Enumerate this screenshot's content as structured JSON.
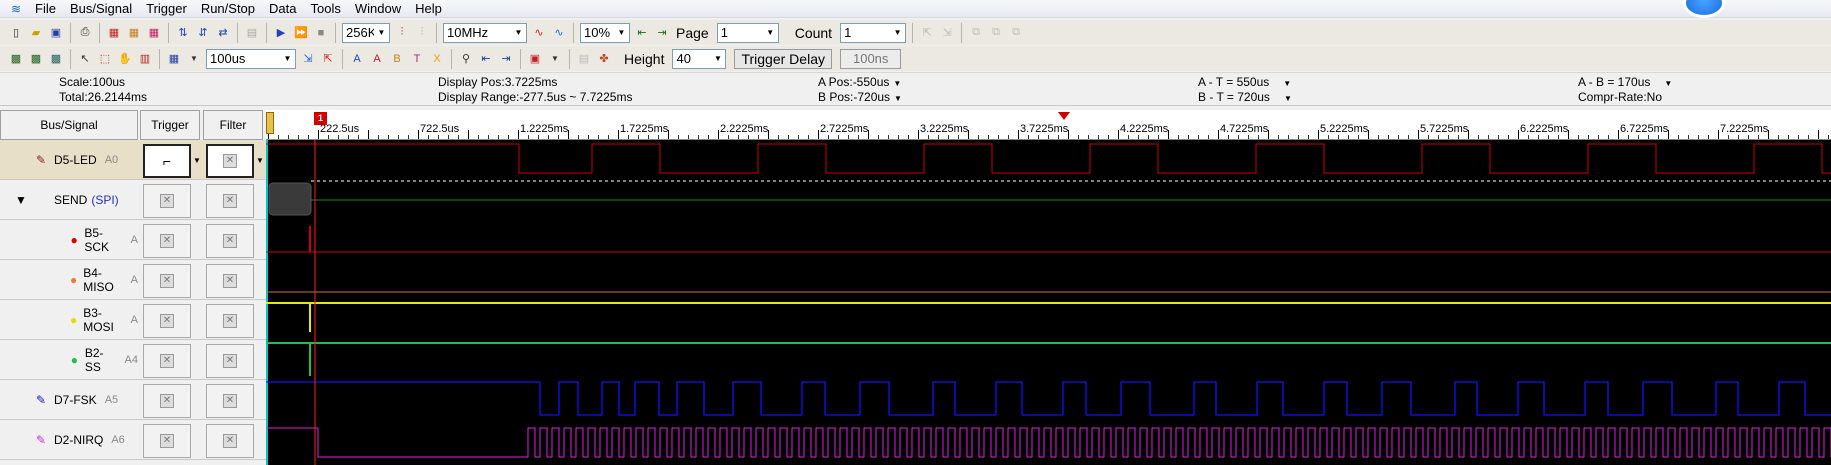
{
  "menu": {
    "items": [
      "File",
      "Bus/Signal",
      "Trigger",
      "Run/Stop",
      "Data",
      "Tools",
      "Window",
      "Help"
    ]
  },
  "toolbar1": {
    "sample_depth": "256K",
    "sample_rate": "10MHz",
    "trigger_pos": "10%",
    "page_label": "Page",
    "page_value": "1",
    "count_label": "Count",
    "count_value": "1"
  },
  "toolbar2": {
    "timebase": "100us",
    "height_label": "Height",
    "height_value": "40",
    "trigger_delay_label": "Trigger Delay",
    "trigger_delay_value": "100ns"
  },
  "info": {
    "scale": "Scale:100us",
    "total": "Total:26.2144ms",
    "display_pos": "Display Pos:3.7225ms",
    "display_range": "Display Range:-277.5us ~ 7.7225ms",
    "a_pos": "A Pos:-550us",
    "b_pos": "B Pos:-720us",
    "a_t": "A - T = 550us",
    "b_t": "B - T = 720us",
    "a_b": "A - B = 170us",
    "compr": "Compr-Rate:No"
  },
  "columns": {
    "bus_signal": "Bus/Signal",
    "trigger": "Trigger",
    "filter": "Filter"
  },
  "signals": [
    {
      "name": "D5-LED",
      "channel": "A0",
      "icon": "pen-icon",
      "color": "#8b1a1a"
    },
    {
      "name": "SEND",
      "protocol": "(SPI)",
      "icon": "collapse-triangle-icon",
      "color": "#000000"
    },
    {
      "name": "B5-SCK",
      "channel": "A",
      "icon": "dot-icon",
      "color": "#e00000"
    },
    {
      "name": "B4-MISO",
      "channel": "A",
      "icon": "dot-icon",
      "color": "#e08040"
    },
    {
      "name": "B3-MOSI",
      "channel": "A",
      "icon": "dot-icon",
      "color": "#f0f000"
    },
    {
      "name": "B2-SS",
      "channel": "A4",
      "icon": "dot-icon",
      "color": "#20c040"
    },
    {
      "name": "D7-FSK",
      "channel": "A5",
      "icon": "pen-icon",
      "color": "#1010e0"
    },
    {
      "name": "D2-NIRQ",
      "channel": "A6",
      "icon": "pen-icon",
      "color": "#e020e0"
    }
  ],
  "ruler": {
    "labels": [
      "222.5us",
      "722.5us",
      "1.2225ms",
      "1.7225ms",
      "2.2225ms",
      "2.7225ms",
      "3.2225ms",
      "3.7225ms",
      "4.2225ms",
      "4.7225ms",
      "5.2225ms",
      "5.7225ms",
      "6.2225ms",
      "6.7225ms",
      "7.2225ms"
    ],
    "cursor_flag": "1"
  },
  "colors": {
    "led": "#d00000",
    "spi": "#1f8a1f",
    "sck": "#d00000",
    "miso": "#d07030",
    "mosi": "#e8e800",
    "ss": "#20c040",
    "fsk": "#1010ff",
    "nirq": "#e020e0"
  }
}
